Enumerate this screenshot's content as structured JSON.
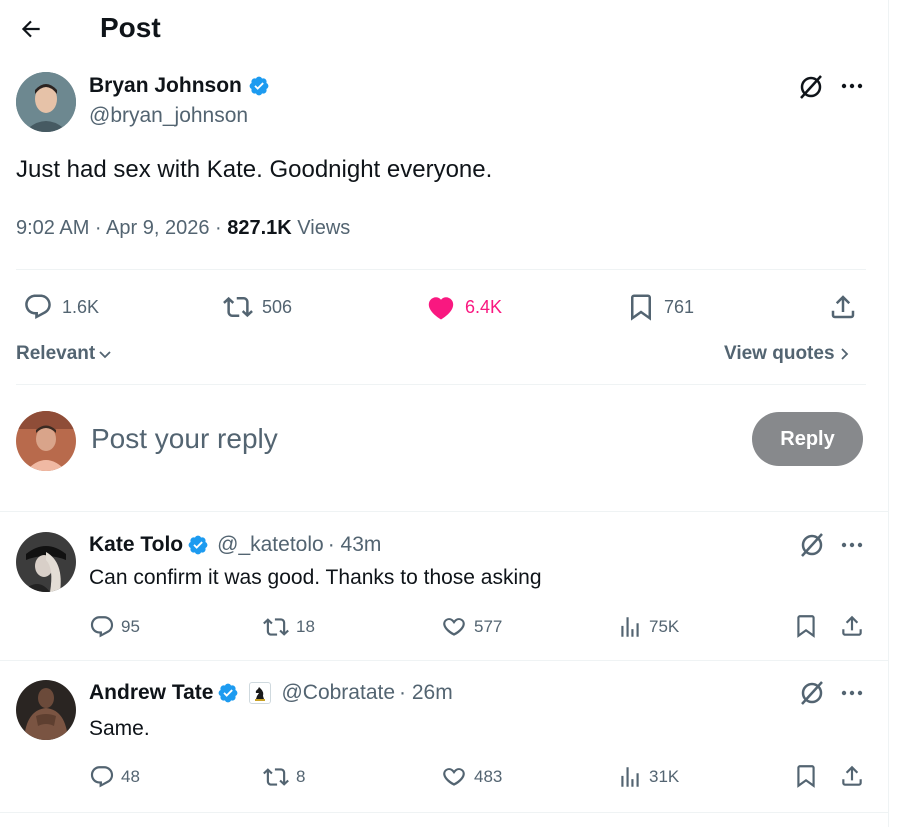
{
  "header": {
    "title": "Post"
  },
  "post": {
    "author_name": "Bryan Johnson",
    "handle": "@bryan_johnson",
    "text": "Just had sex with Kate. Goodnight everyone.",
    "timestamp": "9:02 AM · Apr 9, 2026 · ",
    "views_count": "827.1K",
    "views_label": " Views",
    "stats": {
      "replies": "1.6K",
      "reposts": "506",
      "likes": "6.4K",
      "bookmarks": "761"
    },
    "like_color": "#f91880"
  },
  "sort": {
    "label": "Relevant",
    "view_quotes": "View quotes"
  },
  "composer": {
    "placeholder": "Post your reply",
    "reply_button": "Reply"
  },
  "replies": [
    {
      "author_name": "Kate Tolo",
      "handle": "@_katetolo",
      "time": " · 43m",
      "text": "Can confirm it was good. Thanks to those asking",
      "replies": "95",
      "reposts": "18",
      "likes": "577",
      "views": "75K"
    },
    {
      "author_name": "Andrew Tate",
      "handle": "@Cobratate",
      "time": " · 26m",
      "text": "Same.",
      "replies": "48",
      "reposts": "8",
      "likes": "483",
      "views": "31K"
    }
  ],
  "colors": {
    "verified": "#1d9bf0",
    "text": "#0f1419",
    "muted": "#536471",
    "reply_button_bg": "#87898c"
  }
}
